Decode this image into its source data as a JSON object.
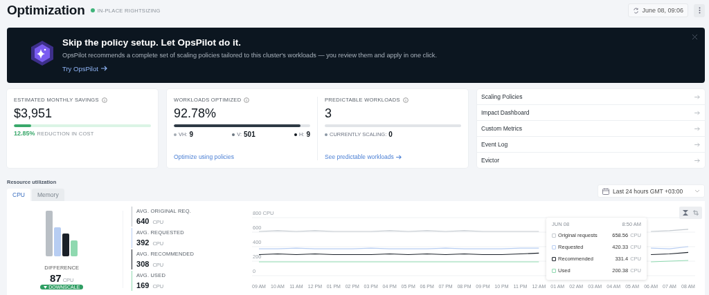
{
  "header": {
    "title": "Optimization",
    "badge": {
      "label": "IN-PLACE RIGHTSIZING",
      "color": "#3fb47a"
    },
    "refresh_button": "June 08, 09:06"
  },
  "banner": {
    "title": "Skip the policy setup. Let OpsPilot do it.",
    "description": "OpsPilot recommends a complete set of scaling policies tailored to this cluster's workloads — you review them and apply in one click.",
    "link": "Try OpsPilot"
  },
  "savings": {
    "label": "ESTIMATED MONTHLY SAVINGS",
    "value": "$3,951",
    "level": 0.1285,
    "percent": "12.85%",
    "caption": "REDUCTION IN COST"
  },
  "workloads_optimized": {
    "label": "WORKLOADS OPTIMIZED",
    "value": "92.78%",
    "level": 0.9278,
    "breakdown": [
      {
        "label": "VH:",
        "value": "9",
        "color": "#a3abb3"
      },
      {
        "label": "V:",
        "value": "501",
        "color": "#6b7680"
      },
      {
        "label": "H:",
        "value": "9",
        "color": "#111820"
      }
    ],
    "link": "Optimize using policies"
  },
  "predictable_workloads": {
    "label": "PREDICTABLE WORKLOADS",
    "value": "3",
    "level": 0,
    "scaling": {
      "label": "CURRENTLY SCALING:",
      "value": "0"
    },
    "link": "See predictable workloads"
  },
  "nav": [
    {
      "label": "Scaling Policies"
    },
    {
      "label": "Impact Dashboard"
    },
    {
      "label": "Custom Metrics"
    },
    {
      "label": "Event Log"
    },
    {
      "label": "Evictor"
    }
  ],
  "resource_utilization": {
    "title": "Resource utilization",
    "tabs": [
      {
        "label": "CPU",
        "selected": true
      },
      {
        "label": "Memory",
        "selected": false
      }
    ],
    "range": "Last 24 hours GMT +03:00",
    "difference": {
      "label": "DIFFERENCE",
      "value": "87",
      "unit": "CPU",
      "badge": "DOWNSCALE"
    },
    "stats": [
      {
        "label": "AVG. ORIGINAL REQ.",
        "value": "640",
        "unit": "CPU",
        "color": "#b9bfc5"
      },
      {
        "label": "AVG. REQUESTED",
        "value": "392",
        "unit": "CPU",
        "color": "#b7cdf2"
      },
      {
        "label": "AVG. RECOMMENDED",
        "value": "308",
        "unit": "CPU",
        "color": "#1a2028"
      },
      {
        "label": "AVG. USED",
        "value": "169",
        "unit": "CPU",
        "color": "#8fd9b0"
      }
    ],
    "chart_data": {
      "type": "line",
      "categories": [
        "09 AM",
        "10 AM",
        "11 AM",
        "12 PM",
        "01 PM",
        "02 PM",
        "03 PM",
        "04 PM",
        "05 PM",
        "06 PM",
        "07 PM",
        "08 PM",
        "09 PM",
        "10 PM",
        "11 PM",
        "12 AM",
        "01 AM",
        "02 AM",
        "03 AM",
        "04 AM",
        "05 AM",
        "06 AM",
        "07 AM",
        "08 AM"
      ],
      "ylim": [
        0,
        800
      ],
      "grid": true,
      "legend": "right",
      "yticks": [
        0,
        200,
        400,
        600,
        {
          "value": 800,
          "label": "800 CPU"
        }
      ],
      "series": [
        {
          "name": "Original requests",
          "color": "#c3c9cf",
          "values": [
            610,
            620,
            610,
            620,
            610,
            610,
            610,
            620,
            610,
            620,
            610,
            620,
            610,
            610,
            610,
            610,
            null,
            null,
            null,
            null,
            null,
            610,
            620,
            640
          ]
        },
        {
          "name": "Requested",
          "color": "#b7cdf2",
          "values": [
            370,
            370,
            380,
            370,
            370,
            370,
            380,
            370,
            370,
            370,
            380,
            370,
            370,
            370,
            380,
            380,
            null,
            null,
            null,
            null,
            null,
            380,
            370,
            400
          ]
        },
        {
          "name": "Recommended",
          "color": "#1a2028",
          "values": [
            290,
            300,
            290,
            300,
            290,
            290,
            290,
            300,
            290,
            300,
            290,
            300,
            290,
            290,
            300,
            310,
            null,
            null,
            null,
            null,
            null,
            290,
            300,
            320
          ]
        },
        {
          "name": "Used",
          "color": "#8fd9b0",
          "values": [
            190,
            190,
            190,
            190,
            190,
            190,
            190,
            190,
            190,
            190,
            190,
            190,
            190,
            190,
            190,
            190,
            null,
            null,
            null,
            null,
            null,
            190,
            200,
            210
          ]
        }
      ]
    },
    "tooltip": {
      "date": "JUN 08",
      "time": "8:50 AM",
      "rows": [
        {
          "value": "658.56",
          "unit": "CPU"
        },
        {
          "value": "420.33",
          "unit": "CPU"
        },
        {
          "value": "331.4",
          "unit": "CPU"
        },
        {
          "value": "200.38",
          "unit": "CPU"
        }
      ]
    }
  }
}
